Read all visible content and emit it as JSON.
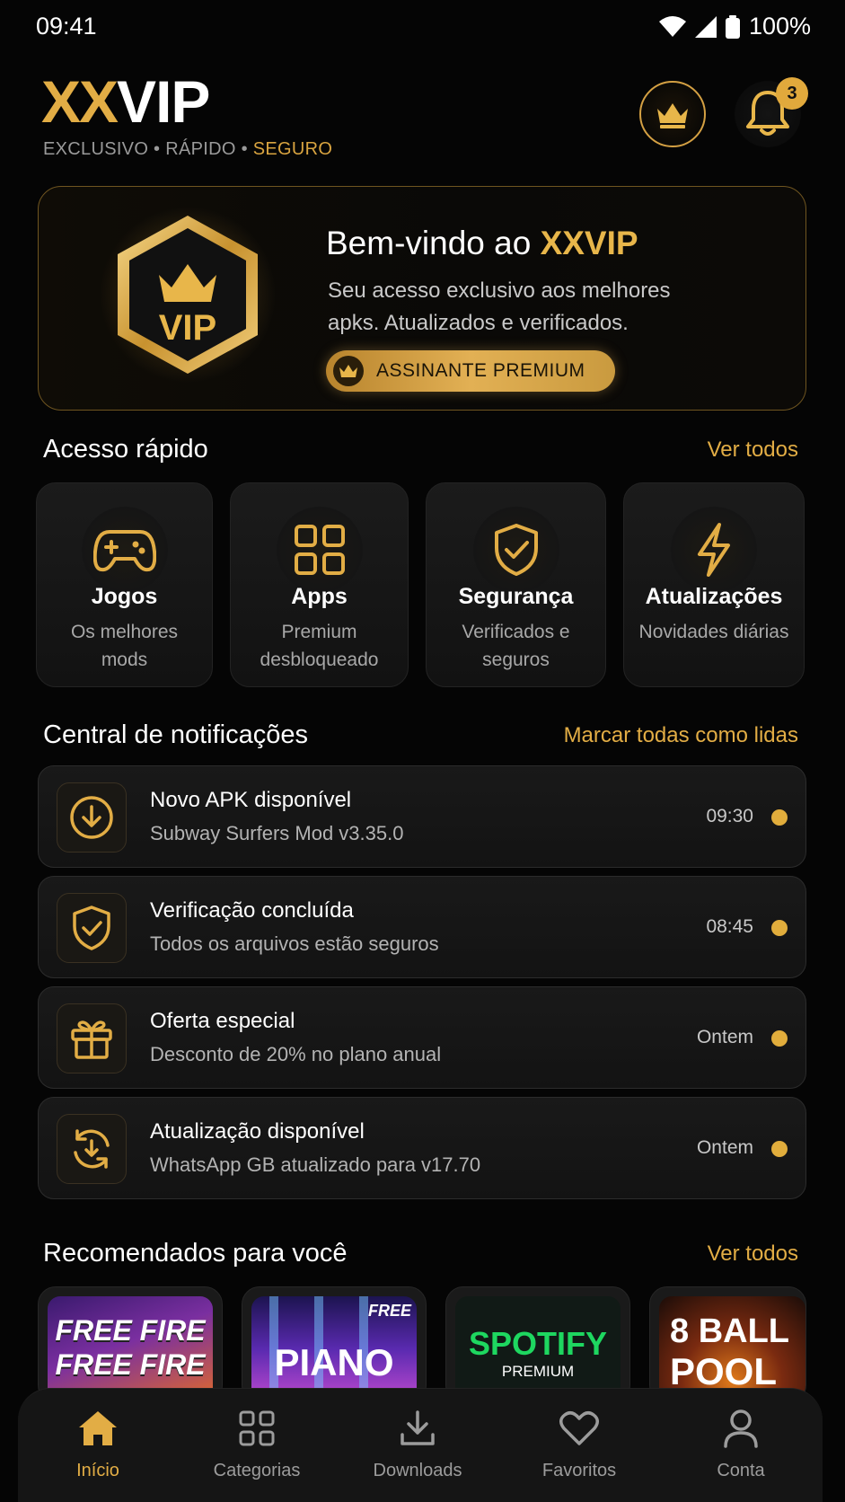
{
  "status_bar": {
    "time": "09:41",
    "battery": "100%"
  },
  "header": {
    "logo_xx": "XX",
    "logo_vip": "VIP",
    "tagline_1": "EXCLUSIVO",
    "tagline_2": "RÁPIDO",
    "tagline_3": "SEGURO",
    "tagline_sep": "•",
    "notification_count": "3"
  },
  "hero": {
    "badge_text": "VIP",
    "title_prefix": "Bem-vindo ao ",
    "title_brand": "XXVIP",
    "description": "Seu acesso exclusivo aos melhores apks. Atualizados e verificados.",
    "pill_label": "ASSINANTE PREMIUM"
  },
  "quick_access": {
    "title": "Acesso rápido",
    "link": "Ver todos",
    "items": [
      {
        "title": "Jogos",
        "subtitle": "Os melhores mods",
        "icon": "gamepad-icon"
      },
      {
        "title": "Apps",
        "subtitle": "Premium desbloqueado",
        "icon": "grid-icon"
      },
      {
        "title": "Segurança",
        "subtitle": "Verificados e seguros",
        "icon": "shield-check-icon"
      },
      {
        "title": "Atualizações",
        "subtitle": "Novidades diárias",
        "icon": "lightning-icon"
      }
    ]
  },
  "notifications": {
    "title": "Central de notificações",
    "link": "Marcar todas como lidas",
    "items": [
      {
        "title": "Novo APK disponível",
        "subtitle": "Subway Surfers Mod v3.35.0",
        "time": "09:30",
        "icon": "download-circle-icon"
      },
      {
        "title": "Verificação concluída",
        "subtitle": "Todos os arquivos estão seguros",
        "time": "08:45",
        "icon": "shield-check-icon"
      },
      {
        "title": "Oferta especial",
        "subtitle": "Desconto de 20% no plano anual",
        "time": "Ontem",
        "icon": "gift-icon"
      },
      {
        "title": "Atualização disponível",
        "subtitle": "WhatsApp GB atualizado para v17.70",
        "time": "Ontem",
        "icon": "refresh-download-icon"
      }
    ]
  },
  "recommended": {
    "title": "Recomendados para você",
    "link": "Ver todos",
    "items": [
      {
        "line1": "FREE FIRE",
        "line2": "FREE FIRE"
      },
      {
        "line1": "PIANO",
        "tag": "FREE"
      },
      {
        "line1": "SPOTIFY",
        "line2": "PREMIUM"
      },
      {
        "line1": "8 BALL",
        "line2": "POOL"
      }
    ]
  },
  "bottom_nav": {
    "items": [
      {
        "label": "Início",
        "icon": "home-icon",
        "active": true
      },
      {
        "label": "Categorias",
        "icon": "grid-icon"
      },
      {
        "label": "Downloads",
        "icon": "download-icon"
      },
      {
        "label": "Favoritos",
        "icon": "heart-icon"
      },
      {
        "label": "Conta",
        "icon": "user-icon"
      }
    ]
  },
  "colors": {
    "accent": "#e2ad45",
    "background": "#050505",
    "card": "#161616"
  }
}
